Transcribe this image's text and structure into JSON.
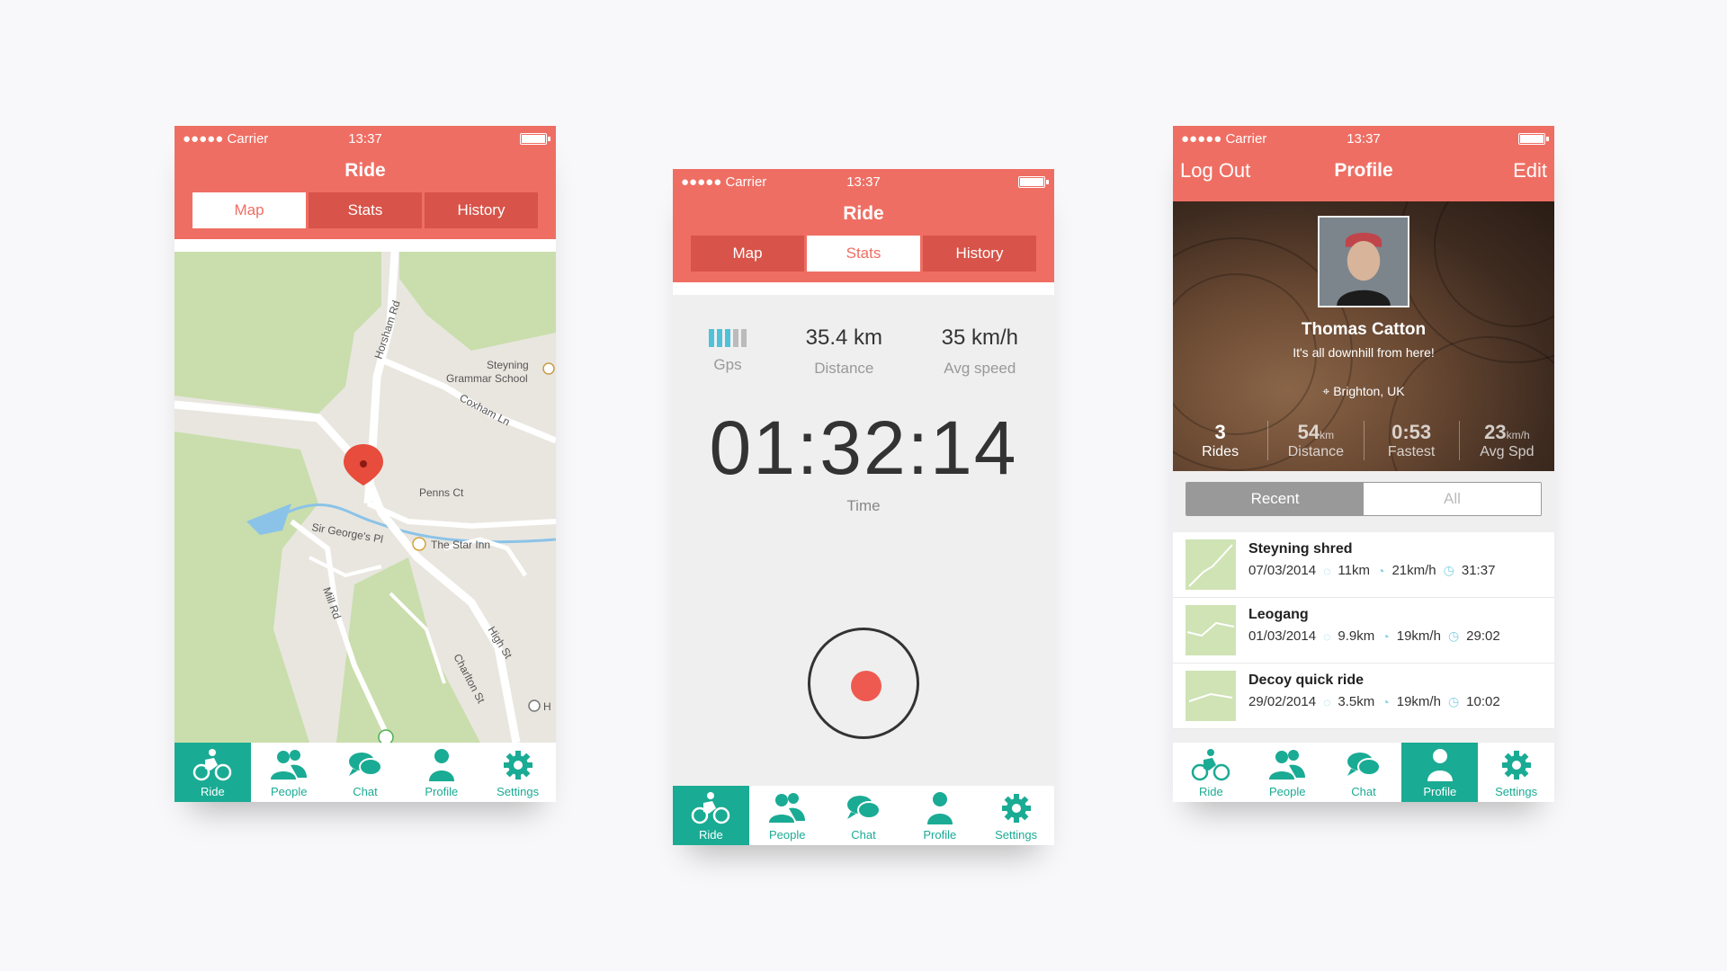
{
  "status": {
    "carrier": "●●●●● Carrier",
    "time": "13:37"
  },
  "tabs": [
    "Ride",
    "People",
    "Chat",
    "Profile",
    "Settings"
  ],
  "colors": {
    "brand": "#ef6e63",
    "accent": "#1aab94",
    "segment_dark": "#d85349"
  },
  "screen_map": {
    "title": "Ride",
    "segments": [
      "Map",
      "Stats",
      "History"
    ],
    "map_labels": {
      "horsham": "Horsham Rd",
      "school_1": "Steyning",
      "school_2": "Grammar School",
      "coxham": "Coxham Ln",
      "penns": "Penns Ct",
      "sirgeorge": "Sir George's Pl",
      "starinn": "The Star Inn",
      "mill": "Mill Rd",
      "high": "High St",
      "charlton": "Charlton St",
      "h": "H"
    }
  },
  "screen_stats": {
    "title": "Ride",
    "segments": [
      "Map",
      "Stats",
      "History"
    ],
    "gps_label": "Gps",
    "distance": {
      "value": "35.4 km",
      "label": "Distance"
    },
    "speed": {
      "value": "35 km/h",
      "label": "Avg speed"
    },
    "time": {
      "value": "01:32:14",
      "label": "Time"
    }
  },
  "screen_profile": {
    "left": "Log Out",
    "title": "Profile",
    "right": "Edit",
    "name": "Thomas Catton",
    "bio": "It's all downhill from here!",
    "location": "Brighton, UK",
    "stats": [
      {
        "num": "3",
        "unit": "",
        "label": "Rides"
      },
      {
        "num": "54",
        "unit": "km",
        "label": "Distance"
      },
      {
        "num": "0:53",
        "unit": "",
        "label": "Fastest"
      },
      {
        "num": "23",
        "unit": "km/h",
        "label": "Avg Spd"
      }
    ],
    "filter": [
      "Recent",
      "All"
    ],
    "rides": [
      {
        "name": "Steyning shred",
        "date": "07/03/2014",
        "dist": "11km",
        "speed": "21km/h",
        "time": "31:37"
      },
      {
        "name": "Leogang",
        "date": "01/03/2014",
        "dist": "9.9km",
        "speed": "19km/h",
        "time": "29:02"
      },
      {
        "name": "Decoy quick ride",
        "date": "29/02/2014",
        "dist": "3.5km",
        "speed": "19km/h",
        "time": "10:02"
      }
    ]
  }
}
